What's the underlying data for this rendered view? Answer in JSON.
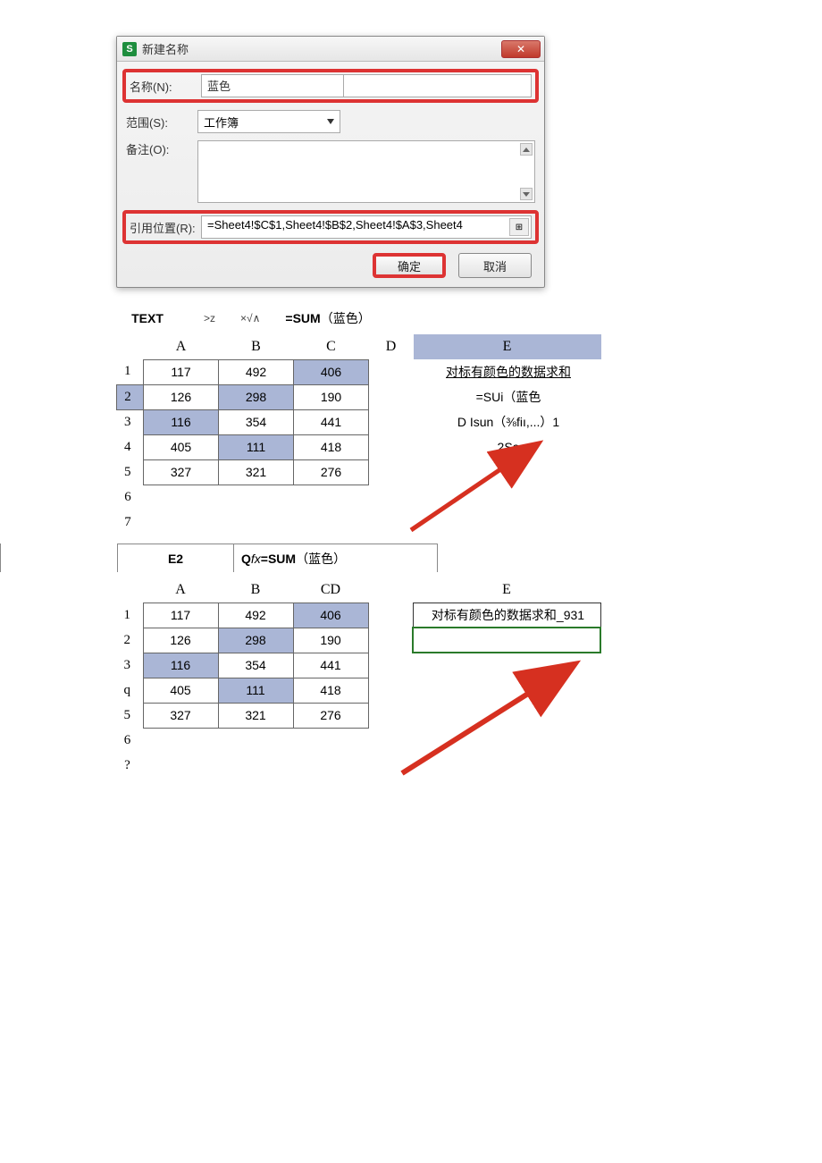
{
  "dialog": {
    "title": "新建名称",
    "icon_letter": "S",
    "name_label": "名称(N):",
    "name_value": "蓝色",
    "scope_label": "范围(S):",
    "scope_value": "工作簿",
    "comment_label": "备注(O):",
    "ref_label": "引用位置(R):",
    "ref_value": "=Sheet4!$C$1,Sheet4!$B$2,Sheet4!$A$3,Sheet4",
    "ref_icon": "⊞",
    "ok": "确定",
    "cancel": "取消",
    "close": "✕"
  },
  "fbar1": {
    "cellref": "TEXT",
    "ctrl1": ">z",
    "ctrl2": "×√∧",
    "formula_prefix": "=SUM",
    "formula_arg": "（蓝色）"
  },
  "sheet1": {
    "col_headers": [
      "A",
      "B",
      "C",
      "D",
      "E"
    ],
    "rows": [
      "1",
      "2",
      "3",
      "4",
      "5",
      "6",
      "7"
    ],
    "data": [
      [
        "117",
        "492",
        "406"
      ],
      [
        "126",
        "298",
        "190"
      ],
      [
        "116",
        "354",
        "441"
      ],
      [
        "405",
        "111",
        "418"
      ],
      [
        "327",
        "321",
        "276"
      ]
    ],
    "e1": "对标有颜色的数据求和",
    "e2": "=SUi（蓝色",
    "e3": "D Isun（⅜fiı,...）1",
    "e4": "2Sa"
  },
  "fbar2": {
    "cellref": "E2",
    "formula": "Qfx=SUM（蓝色）"
  },
  "sheet2": {
    "col_headers": [
      "A",
      "B",
      "CD",
      "",
      "E"
    ],
    "rows": [
      "1",
      "2",
      "3",
      "q",
      "5",
      "6",
      "?"
    ],
    "data": [
      [
        "117",
        "492",
        "406"
      ],
      [
        "126",
        "298",
        "190"
      ],
      [
        "116",
        "354",
        "441"
      ],
      [
        "405",
        "111",
        "418"
      ],
      [
        "327",
        "321",
        "276"
      ]
    ],
    "e1": "对标有颜色的数据求和",
    "e1_suffix": "_931"
  }
}
